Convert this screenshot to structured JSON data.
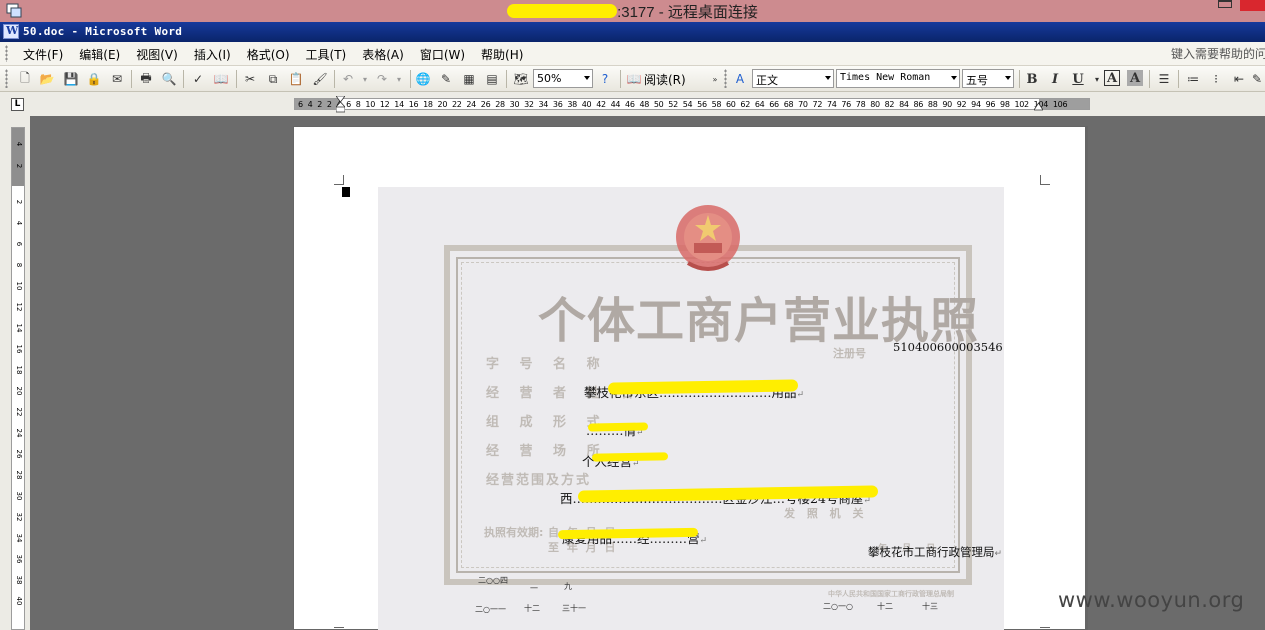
{
  "remote_window": {
    "title_suffix": ":3177 - 远程桌面连接"
  },
  "word": {
    "title": "50.doc - Microsoft Word",
    "menu": [
      "文件(F)",
      "编辑(E)",
      "视图(V)",
      "插入(I)",
      "格式(O)",
      "工具(T)",
      "表格(A)",
      "窗口(W)",
      "帮助(H)"
    ],
    "help_placeholder": "键入需要帮助的问题",
    "toolbar": {
      "zoom": "50%",
      "read_label": "阅读(R)",
      "style": "正文",
      "font": "Times New Roman",
      "size": "五号",
      "bold": "B",
      "italic": "I",
      "underline": "U",
      "char_border": "A",
      "char_shade": "A"
    },
    "ruler": {
      "corner": "L",
      "h_numbers": "6 4 2 2 4 6 8 10 12 14 16 18 20 22 24 26 28 30 32 34 36 38 40 42 44 46 48 50 52 54 56 58 60 62 64 66 68 70 72 74 76 78 80 82 84 86 88 90 92 94 96 98 102 104 106",
      "v_numbers": [
        "4",
        "2",
        "2",
        "4",
        "6",
        "8",
        "10",
        "12",
        "14",
        "16",
        "18",
        "20",
        "22",
        "24",
        "26",
        "28",
        "30",
        "32",
        "34",
        "36",
        "38",
        "40"
      ]
    }
  },
  "license": {
    "title": "个体工商户营业执照",
    "reg_label": "注册号",
    "reg_number": "510400600003546",
    "labels": [
      "字 号 名 称",
      "经 营 者 姓 名",
      "组 成 形 式",
      "经 营 场 所",
      "经营范围及方式"
    ],
    "expiry_label": "执照有效期:",
    "expiry_text": "自    年    月    日",
    "expiry_text2": "至    年    月    日",
    "issuer_label": "发 照 机 关",
    "date_label": "年 月 日",
    "footer_print": "中华人民共和国国家工商行政管理总局制",
    "typed": {
      "name_line": "攀枝花市东区………………………用品",
      "form": "………情",
      "form_text": "个人经营",
      "place": "西………………………………区金沙江…号楼24号商屋",
      "scope": "康复用品……经………营",
      "issuer": "攀枝花市工商行政管理局",
      "date_a": "二○○四",
      "date_b": "一",
      "date_c": "九",
      "date_d": "二○一一",
      "date_e": "十二",
      "date_f": "三十一",
      "date_g": "二○一○",
      "date_h": "十二",
      "date_i": "十三"
    }
  },
  "watermark": "www.wooyun.org"
}
